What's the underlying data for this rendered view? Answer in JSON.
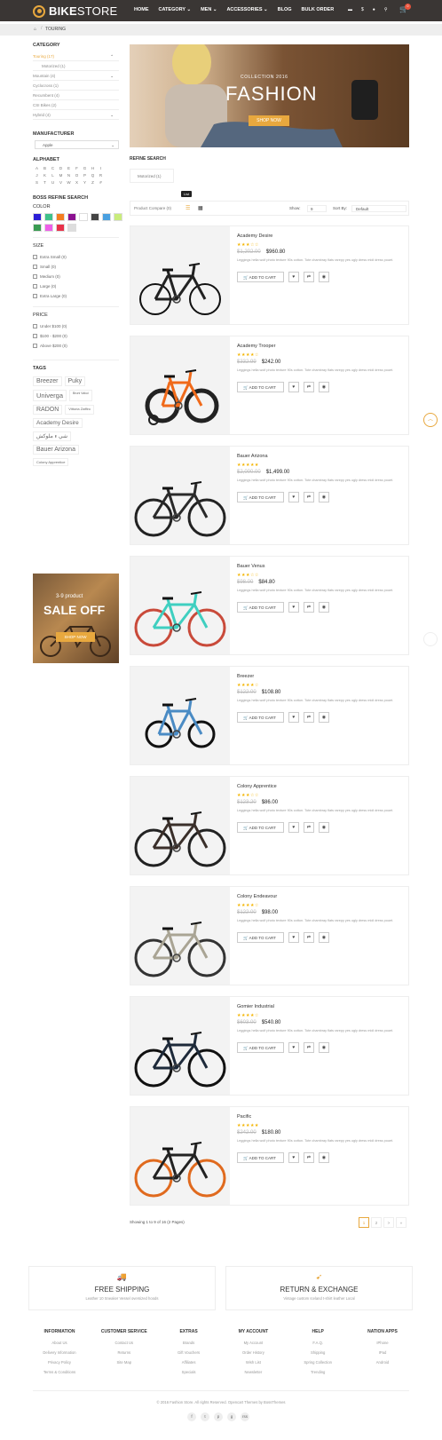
{
  "header": {
    "logo_bold": "BIKE",
    "logo_thin": "STORE",
    "nav": [
      "HOME",
      "CATEGORY ⌄",
      "MEN ⌄",
      "ACCESSORIES ⌄",
      "BLOG",
      "BULK ORDER"
    ],
    "cart_count": "0"
  },
  "breadcrumb": {
    "current": "TOURING"
  },
  "sidebar": {
    "category_title": "CATEGORY",
    "categories": [
      {
        "label": "Touring (17)",
        "active": true,
        "chevron": "⌃"
      },
      {
        "label": "Motorized (1)",
        "sub": true
      },
      {
        "label": "Mountain (4)",
        "chevron": "⌄"
      },
      {
        "label": "Cyclocross (1)"
      },
      {
        "label": "Recumbent (4)"
      },
      {
        "label": "CSI Bikes (2)"
      },
      {
        "label": "Hybrid (4)",
        "chevron": "⌄"
      }
    ],
    "manufacturer_title": "MANUFACTURER",
    "manufacturer_value": "Apple",
    "alphabet_title": "ALPHABET",
    "alphabet": [
      "A",
      "B",
      "C",
      "D",
      "E",
      "F",
      "G",
      "H",
      "I",
      "J",
      "K",
      "L",
      "M",
      "N",
      "O",
      "P",
      "Q",
      "R",
      "S",
      "T",
      "U",
      "V",
      "W",
      "X",
      "Y",
      "Z",
      "#"
    ],
    "refine_title": "BOSS REFINE SEARCH",
    "color_title": "COLOR",
    "colors": [
      "#2b1ed6",
      "#3fc18a",
      "#f47d20",
      "#8b1190",
      "#ffffff",
      "#444444",
      "#4aa0e0",
      "#c9ec7c",
      "#3a9b52",
      "#ee5fe8",
      "#e8324a",
      "#dddddd"
    ],
    "size_title": "SIZE",
    "sizes": [
      "Extra Small (0)",
      "Small (0)",
      "Medium (0)",
      "Large (0)",
      "Extra Large (0)"
    ],
    "price_title": "PRICE",
    "prices": [
      "Under $100 (0)",
      "$100 - $200 (0)",
      "Above $200 (0)"
    ],
    "tags_title": "TAGS",
    "tags": [
      {
        "label": "Breezer",
        "size": 7
      },
      {
        "label": "Puky",
        "size": 7
      },
      {
        "label": "Univerga",
        "size": 7.5
      },
      {
        "label": "Bruni Vakui",
        "size": 3.5
      },
      {
        "label": "RADON",
        "size": 7
      },
      {
        "label": "Vittoria Zaffiro",
        "size": 4
      },
      {
        "label": "Academy Desire",
        "size": 6.5
      },
      {
        "label": "شي ء ملوكش",
        "size": 6
      },
      {
        "label": "Bauer Arizona",
        "size": 7
      },
      {
        "label": "Colony Apprentice",
        "size": 4
      }
    ],
    "promo": {
      "top": "3-9 product",
      "big": "SALE OFF",
      "button": "SHOP NOW"
    }
  },
  "banner": {
    "subtitle": "COLLECTION 2016",
    "title": "FASHION",
    "button": "SHOP NOW"
  },
  "refine": {
    "title": "REFINE SEARCH",
    "chip": "Motorized (1)"
  },
  "toolbar": {
    "compare": "Product Compare (0)",
    "tooltip": "List",
    "show_label": "Show:",
    "show_value": "9",
    "sort_label": "Sort By:",
    "sort_value": "Default"
  },
  "product_common": {
    "description": "Leggings hella wolf photo texture 90s cotton. Tote chambray flats rarepy yes ugly dress midi dress pouet.",
    "add_to_cart": "ADD TO CART"
  },
  "products": [
    {
      "name": "Academy Desire",
      "old": "$1,202.00",
      "price": "$960.80",
      "rating": 3,
      "frame": "#222222",
      "tire": "#111111",
      "style": "folding"
    },
    {
      "name": "Academy Trooper",
      "old": "$332.99",
      "price": "$242.00",
      "rating": 4,
      "frame": "#f06a1a",
      "tire": "#222222",
      "style": "kids"
    },
    {
      "name": "Bauer Arizona",
      "old": "$2,000.00",
      "price": "$1,499.00",
      "rating": 5,
      "frame": "#2a2a2a",
      "tire": "#222222",
      "style": "road"
    },
    {
      "name": "Bauer Venus",
      "old": "$98.00",
      "price": "$84.80",
      "rating": 3,
      "frame": "#3fcfc0",
      "tire": "#c94a3a",
      "style": "cruiser"
    },
    {
      "name": "Breezer",
      "old": "$122.00",
      "price": "$108.80",
      "rating": 4,
      "frame": "#4a8bc4",
      "tire": "#111111",
      "style": "bmx"
    },
    {
      "name": "Colony Apprentice",
      "old": "$123.20",
      "price": "$86.00",
      "rating": 3,
      "frame": "#3a2f2a",
      "tire": "#222222",
      "style": "city"
    },
    {
      "name": "Colony Endeavour",
      "old": "$122.00",
      "price": "$98.00",
      "rating": 4,
      "frame": "#a9a494",
      "tire": "#333333",
      "style": "road"
    },
    {
      "name": "Gomier Industrial",
      "old": "$603.00",
      "price": "$540.80",
      "rating": 4,
      "frame": "#1e2a3a",
      "tire": "#111111",
      "style": "mtb"
    },
    {
      "name": "Pacific",
      "old": "$242.00",
      "price": "$180.80",
      "rating": 5,
      "frame": "#222222",
      "tire": "#e06a1e",
      "style": "road"
    }
  ],
  "pagination": {
    "text": "Showing 1 to 9 of 16 (2 Pages)",
    "pages": [
      "1",
      "2",
      ">",
      "»"
    ]
  },
  "features": [
    {
      "title": "FREE SHIPPING",
      "sub": "Leather 10 Sneaker Vessel oversized hoods"
    },
    {
      "title": "RETURN & EXCHANGE",
      "sub": "Vintage custom Iceland t-shirt leather Local"
    }
  ],
  "footer": {
    "columns": [
      {
        "title": "INFORMATION",
        "links": [
          "About Us",
          "Delivery Information",
          "Privacy Policy",
          "Terms & Conditions"
        ]
      },
      {
        "title": "CUSTOMER SERVICE",
        "links": [
          "Contact Us",
          "Returns",
          "Site Map"
        ]
      },
      {
        "title": "EXTRAS",
        "links": [
          "Brands",
          "Gift Vouchers",
          "Affiliates",
          "Specials"
        ]
      },
      {
        "title": "MY ACCOUNT",
        "links": [
          "My Account",
          "Order History",
          "Wish List",
          "Newsletter"
        ]
      },
      {
        "title": "HELP",
        "links": [
          "F.A.Q.",
          "Shipping",
          "Spring Collection",
          "Trending"
        ]
      },
      {
        "title": "NATION APPS",
        "links": [
          "IPhone",
          "IPad",
          "Android"
        ]
      }
    ],
    "copyright": "© 2016 Fashion Store. All rights Reserved. Opencart Themes by BossThemes",
    "social": [
      "f",
      "t",
      "p",
      "g",
      "rss"
    ]
  }
}
